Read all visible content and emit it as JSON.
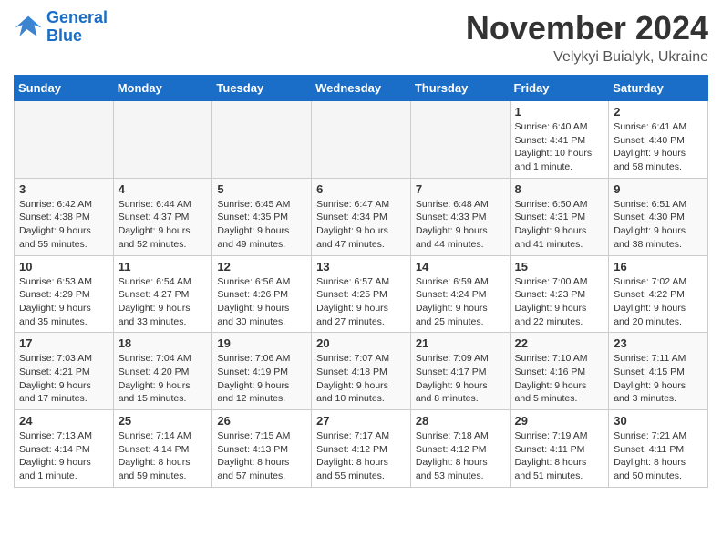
{
  "header": {
    "logo_line1": "General",
    "logo_line2": "Blue",
    "month": "November 2024",
    "location": "Velykyi Buialyk, Ukraine"
  },
  "days_of_week": [
    "Sunday",
    "Monday",
    "Tuesday",
    "Wednesday",
    "Thursday",
    "Friday",
    "Saturday"
  ],
  "weeks": [
    [
      {
        "day": "",
        "info": ""
      },
      {
        "day": "",
        "info": ""
      },
      {
        "day": "",
        "info": ""
      },
      {
        "day": "",
        "info": ""
      },
      {
        "day": "",
        "info": ""
      },
      {
        "day": "1",
        "info": "Sunrise: 6:40 AM\nSunset: 4:41 PM\nDaylight: 10 hours and 1 minute."
      },
      {
        "day": "2",
        "info": "Sunrise: 6:41 AM\nSunset: 4:40 PM\nDaylight: 9 hours and 58 minutes."
      }
    ],
    [
      {
        "day": "3",
        "info": "Sunrise: 6:42 AM\nSunset: 4:38 PM\nDaylight: 9 hours and 55 minutes."
      },
      {
        "day": "4",
        "info": "Sunrise: 6:44 AM\nSunset: 4:37 PM\nDaylight: 9 hours and 52 minutes."
      },
      {
        "day": "5",
        "info": "Sunrise: 6:45 AM\nSunset: 4:35 PM\nDaylight: 9 hours and 49 minutes."
      },
      {
        "day": "6",
        "info": "Sunrise: 6:47 AM\nSunset: 4:34 PM\nDaylight: 9 hours and 47 minutes."
      },
      {
        "day": "7",
        "info": "Sunrise: 6:48 AM\nSunset: 4:33 PM\nDaylight: 9 hours and 44 minutes."
      },
      {
        "day": "8",
        "info": "Sunrise: 6:50 AM\nSunset: 4:31 PM\nDaylight: 9 hours and 41 minutes."
      },
      {
        "day": "9",
        "info": "Sunrise: 6:51 AM\nSunset: 4:30 PM\nDaylight: 9 hours and 38 minutes."
      }
    ],
    [
      {
        "day": "10",
        "info": "Sunrise: 6:53 AM\nSunset: 4:29 PM\nDaylight: 9 hours and 35 minutes."
      },
      {
        "day": "11",
        "info": "Sunrise: 6:54 AM\nSunset: 4:27 PM\nDaylight: 9 hours and 33 minutes."
      },
      {
        "day": "12",
        "info": "Sunrise: 6:56 AM\nSunset: 4:26 PM\nDaylight: 9 hours and 30 minutes."
      },
      {
        "day": "13",
        "info": "Sunrise: 6:57 AM\nSunset: 4:25 PM\nDaylight: 9 hours and 27 minutes."
      },
      {
        "day": "14",
        "info": "Sunrise: 6:59 AM\nSunset: 4:24 PM\nDaylight: 9 hours and 25 minutes."
      },
      {
        "day": "15",
        "info": "Sunrise: 7:00 AM\nSunset: 4:23 PM\nDaylight: 9 hours and 22 minutes."
      },
      {
        "day": "16",
        "info": "Sunrise: 7:02 AM\nSunset: 4:22 PM\nDaylight: 9 hours and 20 minutes."
      }
    ],
    [
      {
        "day": "17",
        "info": "Sunrise: 7:03 AM\nSunset: 4:21 PM\nDaylight: 9 hours and 17 minutes."
      },
      {
        "day": "18",
        "info": "Sunrise: 7:04 AM\nSunset: 4:20 PM\nDaylight: 9 hours and 15 minutes."
      },
      {
        "day": "19",
        "info": "Sunrise: 7:06 AM\nSunset: 4:19 PM\nDaylight: 9 hours and 12 minutes."
      },
      {
        "day": "20",
        "info": "Sunrise: 7:07 AM\nSunset: 4:18 PM\nDaylight: 9 hours and 10 minutes."
      },
      {
        "day": "21",
        "info": "Sunrise: 7:09 AM\nSunset: 4:17 PM\nDaylight: 9 hours and 8 minutes."
      },
      {
        "day": "22",
        "info": "Sunrise: 7:10 AM\nSunset: 4:16 PM\nDaylight: 9 hours and 5 minutes."
      },
      {
        "day": "23",
        "info": "Sunrise: 7:11 AM\nSunset: 4:15 PM\nDaylight: 9 hours and 3 minutes."
      }
    ],
    [
      {
        "day": "24",
        "info": "Sunrise: 7:13 AM\nSunset: 4:14 PM\nDaylight: 9 hours and 1 minute."
      },
      {
        "day": "25",
        "info": "Sunrise: 7:14 AM\nSunset: 4:14 PM\nDaylight: 8 hours and 59 minutes."
      },
      {
        "day": "26",
        "info": "Sunrise: 7:15 AM\nSunset: 4:13 PM\nDaylight: 8 hours and 57 minutes."
      },
      {
        "day": "27",
        "info": "Sunrise: 7:17 AM\nSunset: 4:12 PM\nDaylight: 8 hours and 55 minutes."
      },
      {
        "day": "28",
        "info": "Sunrise: 7:18 AM\nSunset: 4:12 PM\nDaylight: 8 hours and 53 minutes."
      },
      {
        "day": "29",
        "info": "Sunrise: 7:19 AM\nSunset: 4:11 PM\nDaylight: 8 hours and 51 minutes."
      },
      {
        "day": "30",
        "info": "Sunrise: 7:21 AM\nSunset: 4:11 PM\nDaylight: 8 hours and 50 minutes."
      }
    ]
  ]
}
